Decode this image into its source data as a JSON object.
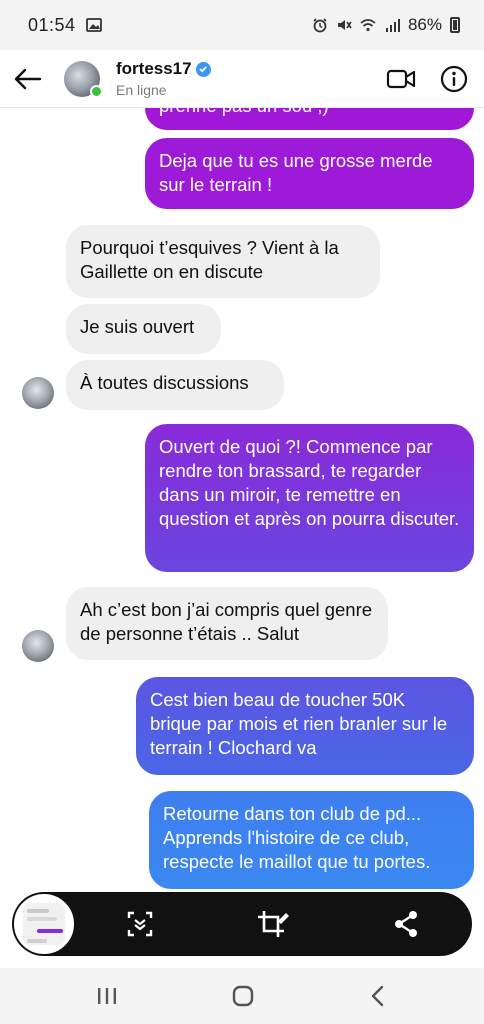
{
  "status_bar": {
    "time": "01:54",
    "battery": "86%",
    "icons": [
      "image-icon",
      "alarm-icon",
      "mute-icon",
      "wifi-icon",
      "signal-icon",
      "battery-icon"
    ]
  },
  "header": {
    "username": "fortess17",
    "status": "En ligne",
    "icons": [
      "back-arrow-icon",
      "verified-badge-icon",
      "video-call-icon",
      "info-icon"
    ]
  },
  "messages": [
    {
      "side": "out",
      "text": "prenne pas un sou ;)",
      "partial": true
    },
    {
      "side": "out",
      "text": "Deja que tu es une grosse merde sur le terrain !"
    },
    {
      "side": "in",
      "text": "Pourquoi t’esquives ? Vient à la Gaillette on en discute"
    },
    {
      "side": "in",
      "text": "Je suis ouvert"
    },
    {
      "side": "in",
      "text": "À toutes discussions"
    },
    {
      "side": "out",
      "text": "Ouvert de quoi ?! Commence par rendre ton brassard, te regarder dans un miroir, te remettre en question et après on pourra discuter."
    },
    {
      "side": "in",
      "text": "Ah c’est bon j’ai compris quel genre de personne t’étais .. Salut"
    },
    {
      "side": "out",
      "text": "Cest bien beau de toucher 50K brique par mois et rien branler sur le terrain ! Clochard va"
    },
    {
      "side": "out",
      "text": "Retourne dans ton club de pd... Apprends l'histoire de ce club, respecte le maillot que tu portes."
    }
  ],
  "screenshot_toolbar": {
    "buttons": [
      "scroll-capture-icon",
      "crop-edit-icon",
      "share-icon"
    ]
  },
  "nav_bar": {
    "buttons": [
      "recent-apps-icon",
      "home-icon",
      "back-icon"
    ]
  },
  "colors": {
    "bubble_in": "#efefef",
    "bubble_out_top": "#a117d8",
    "bubble_out_mid": "#7a38dc",
    "bubble_out_low": "#5a57e2",
    "bubble_out_bottom": "#3f7cf0",
    "online": "#3cc13b",
    "verified": "#3897f0"
  }
}
